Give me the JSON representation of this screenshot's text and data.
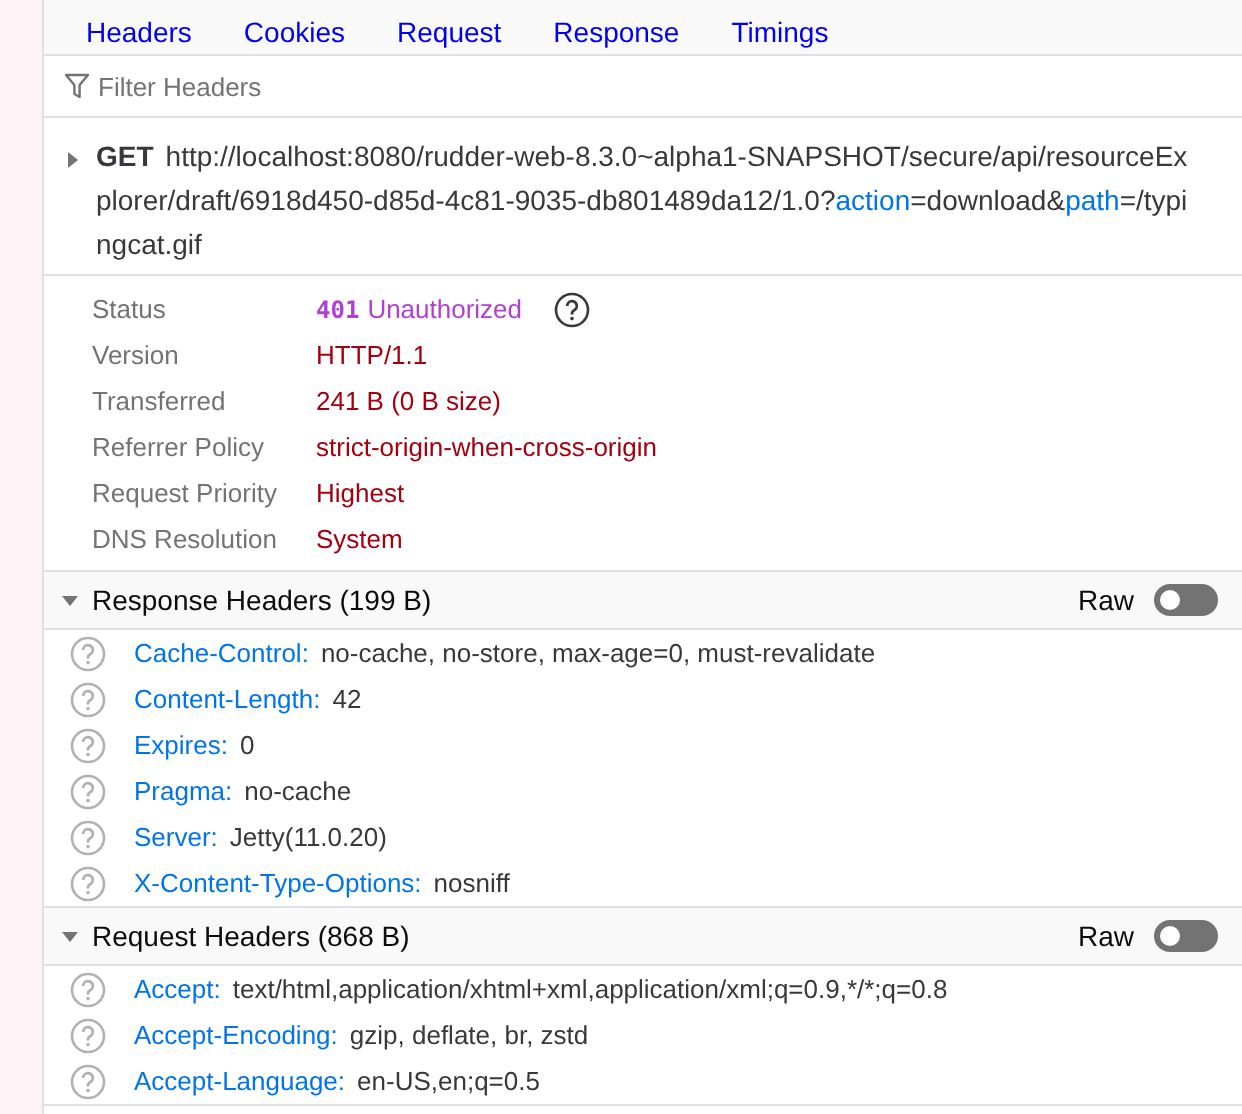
{
  "tabs": [
    {
      "label": "Headers"
    },
    {
      "label": "Cookies"
    },
    {
      "label": "Request"
    },
    {
      "label": "Response"
    },
    {
      "label": "Timings"
    }
  ],
  "filter": {
    "placeholder": "Filter Headers"
  },
  "request_line": {
    "expanded": false,
    "method": "GET",
    "url": [
      {
        "kind": "plain",
        "text": "http://localhost:8080/rudder-web-8.3.0~alpha1-SNAPSHOT/secure/api/resourceExplorer/draft/6918d450-d85d-4c81-9035-db801489da12/1.0?"
      },
      {
        "kind": "param",
        "text": "action"
      },
      {
        "kind": "plain",
        "text": "=download&"
      },
      {
        "kind": "param",
        "text": "path"
      },
      {
        "kind": "plain",
        "text": "=/typingcat.gif"
      }
    ]
  },
  "summary": [
    {
      "kind": "status",
      "label": "Status",
      "code": "401",
      "value": "Unauthorized"
    },
    {
      "kind": "plain",
      "label": "Version",
      "value": "HTTP/1.1"
    },
    {
      "kind": "plain",
      "label": "Transferred",
      "value": "241 B (0 B size)"
    },
    {
      "kind": "plain",
      "label": "Referrer Policy",
      "value": "strict-origin-when-cross-origin"
    },
    {
      "kind": "plain",
      "label": "Request Priority",
      "value": "Highest"
    },
    {
      "kind": "plain",
      "label": "DNS Resolution",
      "value": "System"
    }
  ],
  "sections": [
    {
      "title": "Response Headers (199 B)",
      "expanded": true,
      "raw_label": "Raw",
      "raw": false,
      "headers": [
        {
          "name": "Cache-Control:",
          "value": "no-cache, no-store, max-age=0, must-revalidate"
        },
        {
          "name": "Content-Length:",
          "value": "42"
        },
        {
          "name": "Expires:",
          "value": "0"
        },
        {
          "name": "Pragma:",
          "value": "no-cache"
        },
        {
          "name": "Server:",
          "value": "Jetty(11.0.20)"
        },
        {
          "name": "X-Content-Type-Options:",
          "value": "nosniff"
        }
      ]
    },
    {
      "title": "Request Headers (868 B)",
      "expanded": true,
      "raw_label": "Raw",
      "raw": false,
      "headers": [
        {
          "name": "Accept:",
          "value": "text/html,application/xhtml+xml,application/xml;q=0.9,*/*;q=0.8"
        },
        {
          "name": "Accept-Encoding:",
          "value": "gzip, deflate, br, zstd"
        },
        {
          "name": "Accept-Language:",
          "value": "en-US,en;q=0.5"
        }
      ]
    }
  ]
}
